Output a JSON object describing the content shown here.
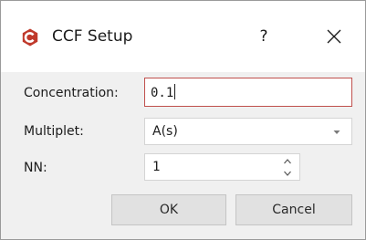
{
  "window": {
    "title": "CCF Setup",
    "help_label": "?",
    "app_icon": "app-logo-icon",
    "close_icon": "close-icon"
  },
  "form": {
    "concentration": {
      "label": "Concentration:",
      "value": "0.1"
    },
    "multiplet": {
      "label": "Multiplet:",
      "selected": "A(s)",
      "icon": "chevron-down-icon"
    },
    "nn": {
      "label": "NN:",
      "value": "1",
      "icons": [
        "spin-up-icon",
        "spin-down-icon"
      ]
    }
  },
  "buttons": {
    "ok_label": "OK",
    "cancel_label": "Cancel"
  },
  "colors": {
    "dialog_bg": "#f0f0f0",
    "titlebar_bg": "#ffffff",
    "app_icon": "#c0392b",
    "focus_border": "#c0504d",
    "button_bg": "#e1e1e1"
  }
}
